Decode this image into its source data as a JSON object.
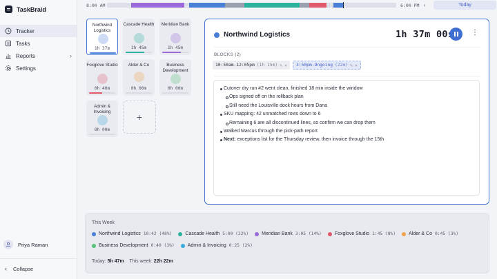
{
  "app": {
    "name": "TaskBraid"
  },
  "sidebar": {
    "nav": [
      {
        "label": "Tracker",
        "icon": "clock-icon",
        "active": true
      },
      {
        "label": "Tasks",
        "icon": "list-icon",
        "active": false
      },
      {
        "label": "Reports",
        "icon": "chart-icon",
        "active": false,
        "has_children": true
      },
      {
        "label": "Settings",
        "icon": "gear-icon",
        "active": false
      }
    ],
    "user": {
      "name": "Priya Raman"
    },
    "collapse_label": "Collapse"
  },
  "timeline": {
    "start_label": "8:00 AM",
    "end_label": "6:00 PM",
    "today_label": "Today",
    "prev_icon": "chevron-left-icon",
    "next_icon": "chevron-right-icon",
    "segments": [
      {
        "start": "8:50am",
        "end": "9:15am",
        "color": "#9b6ad9"
      },
      {
        "start": "9:15am",
        "end": "10:40am",
        "color": "#9b6ad9"
      },
      {
        "start": "10:50am",
        "end": "12:05pm",
        "color": "#4a7fd8"
      },
      {
        "start": "12:05pm",
        "end": "12:45pm",
        "color": "#9aa0ae"
      },
      {
        "start": "12:45pm",
        "end": "2:40pm",
        "color": "#2bb3a0"
      },
      {
        "start": "2:40pm",
        "end": "3:00pm",
        "color": "#9aa0ae"
      },
      {
        "start": "3:00pm",
        "end": "3:35pm",
        "color": "#e15a6b"
      },
      {
        "start": "3:50pm",
        "end": "4:10pm",
        "color": "#4a7fd8"
      }
    ],
    "now": "4:10pm"
  },
  "clients": [
    {
      "name": "Northwind Logistics",
      "time": "1h 37m",
      "color": "#4a7fd8",
      "progress": 1.0,
      "active": true
    },
    {
      "name": "Cascade Health",
      "time": "1h 45m",
      "color": "#2bb3a0",
      "progress": 0.7
    },
    {
      "name": "Meridian Bank",
      "time": "1h 45m",
      "color": "#9b6ad9",
      "progress": 0.7
    },
    {
      "name": "Foxglove Studio",
      "time": "0h 40m",
      "color": "#e15a6b",
      "progress": 0.5
    },
    {
      "name": "Alder & Co",
      "time": "0h 00m",
      "color": "#f0a34a",
      "progress": 0
    },
    {
      "name": "Business Development",
      "time": "0h 00m",
      "color": "#55c27a",
      "progress": 0
    },
    {
      "name": "Admin & Invoicing",
      "time": "0h 00m",
      "color": "#38a9d8",
      "progress": 0
    }
  ],
  "detail": {
    "client": "Northwind Logistics",
    "color": "#4a7fd8",
    "elapsed": "1h 37m 00s",
    "blocks_label": "BLOCKS (2)",
    "blocks": [
      {
        "range": "10:50am-12:05pm",
        "duration": "(1h 15m)",
        "ongoing": false
      },
      {
        "range": "3:50pm-Ongoing",
        "duration": "(22m)",
        "ongoing": true
      }
    ],
    "notes": [
      {
        "level": 0,
        "text": "Cutover dry run #2 went clean, finished 18 min inside the window"
      },
      {
        "level": 1,
        "text": "Ops signed off on the rollback plan"
      },
      {
        "level": 1,
        "text": "Still need the Louisville dock hours from Dana"
      },
      {
        "level": 0,
        "text": "SKU mapping: 42 unmatched rows down to 6"
      },
      {
        "level": 1,
        "text": "Remaining 6 are all discontinued lines, so confirm we can drop them"
      },
      {
        "level": 0,
        "text": "Walked Marcus through the pick-path report"
      },
      {
        "level": 0,
        "bold": "Next:",
        "text": "exceptions list for the Thursday review, then invoice through the 15th"
      }
    ]
  },
  "week": {
    "title": "This Week",
    "items": [
      {
        "name": "Northwind Logistics",
        "value": "10:42 (48%)",
        "color": "#4a7fd8"
      },
      {
        "name": "Cascade Health",
        "value": "5:00 (22%)",
        "color": "#2bb3a0"
      },
      {
        "name": "Meridian Bank",
        "value": "3:05 (14%)",
        "color": "#9b6ad9"
      },
      {
        "name": "Foxglove Studio",
        "value": "1:45 (8%)",
        "color": "#e15a6b"
      },
      {
        "name": "Alder & Co",
        "value": "0:45 (3%)",
        "color": "#f0a34a"
      },
      {
        "name": "Business Development",
        "value": "0:40 (3%)",
        "color": "#55c27a"
      },
      {
        "name": "Admin & Invoicing",
        "value": "0:25 (2%)",
        "color": "#38a9d8"
      }
    ],
    "today_label": "Today:",
    "today_value": "5h 47m",
    "week_label": "This week:",
    "week_value": "22h 22m"
  }
}
